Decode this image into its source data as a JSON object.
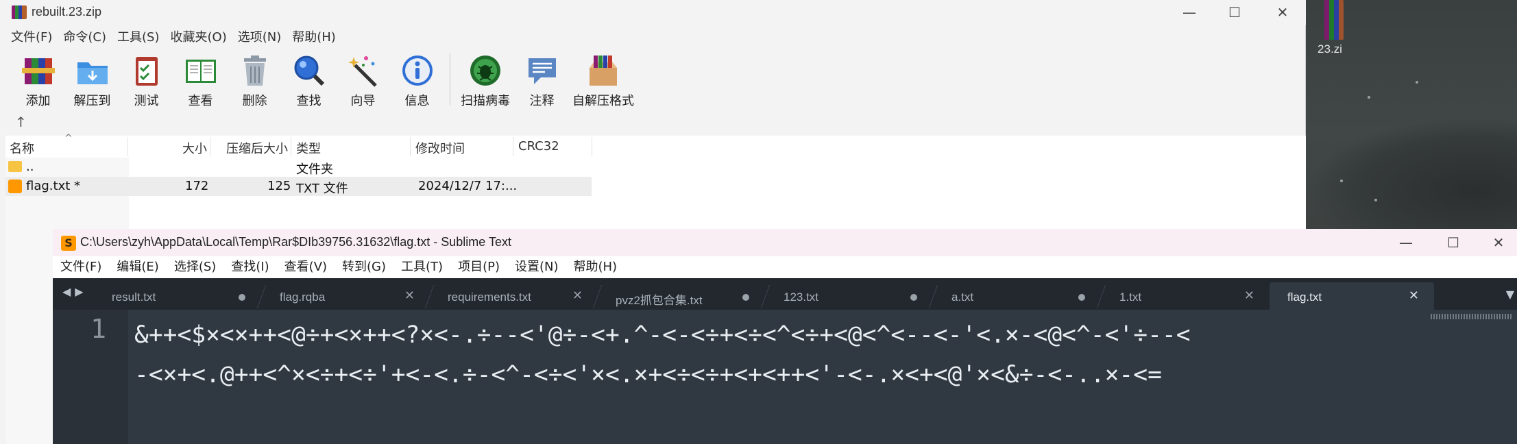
{
  "desktop": {
    "icon_label": "23.zi"
  },
  "rar": {
    "title": "rebuilt.23.zip",
    "menu": [
      "文件(F)",
      "命令(C)",
      "工具(S)",
      "收藏夹(O)",
      "选项(N)",
      "帮助(H)"
    ],
    "toolbar": [
      {
        "label": "添加",
        "icon": "add-archive-icon"
      },
      {
        "label": "解压到",
        "icon": "extract-folder-icon"
      },
      {
        "label": "测试",
        "icon": "test-clipboard-icon"
      },
      {
        "label": "查看",
        "icon": "view-book-icon"
      },
      {
        "label": "删除",
        "icon": "trash-icon"
      },
      {
        "label": "查找",
        "icon": "magnifier-icon"
      },
      {
        "label": "向导",
        "icon": "wizard-wand-icon"
      },
      {
        "label": "信息",
        "icon": "info-icon"
      },
      {
        "label": "扫描病毒",
        "icon": "virus-scan-icon"
      },
      {
        "label": "注释",
        "icon": "comment-icon"
      },
      {
        "label": "自解压格式",
        "icon": "sfx-box-icon"
      }
    ],
    "columns": {
      "name": "名称",
      "size": "大小",
      "packed": "压缩后大小",
      "type": "类型",
      "modified": "修改时间",
      "crc": "CRC32"
    },
    "rows": [
      {
        "name": "..",
        "size": "",
        "packed": "",
        "type": "文件夹",
        "modified": ""
      },
      {
        "name": "flag.txt *",
        "size": "172",
        "packed": "125",
        "type": "TXT 文件",
        "modified": "2024/12/7 17:..."
      }
    ]
  },
  "sublime": {
    "title": "C:\\Users\\zyh\\AppData\\Local\\Temp\\Rar$DIb39756.31632\\flag.txt - Sublime Text",
    "menu": [
      "文件(F)",
      "编辑(E)",
      "选择(S)",
      "查找(I)",
      "查看(V)",
      "转到(G)",
      "工具(T)",
      "项目(P)",
      "设置(N)",
      "帮助(H)"
    ],
    "tabs": [
      {
        "name": "result.txt",
        "state": "dirty"
      },
      {
        "name": "flag.rqba",
        "state": "close"
      },
      {
        "name": "requirements.txt",
        "state": "close"
      },
      {
        "name": "pvz2抓包合集.txt",
        "state": "dirty"
      },
      {
        "name": "123.txt",
        "state": "dirty"
      },
      {
        "name": "a.txt",
        "state": "dirty"
      },
      {
        "name": "1.txt",
        "state": "close"
      },
      {
        "name": "flag.txt",
        "state": "close",
        "active": true
      }
    ],
    "line_number": "1",
    "code_lines": [
      "&++<$×<×++<@÷+<×++<?×<-.÷--<'@÷-<+.^-<-<÷+<÷<^<÷+<@<^<--<-'<.×-<@<^-<'÷--<",
      "-<×+<.@++<^×<÷+<÷'+<-<.÷-<^-<÷<'×<.×+<÷<÷+<+<++<'-<-.×<+<@'×<&÷-<-..×-<="
    ]
  },
  "colors": {
    "sublime_bg": "#303841",
    "sublime_tabbar": "#22282e",
    "rar_bg": "#f3f3f3"
  }
}
